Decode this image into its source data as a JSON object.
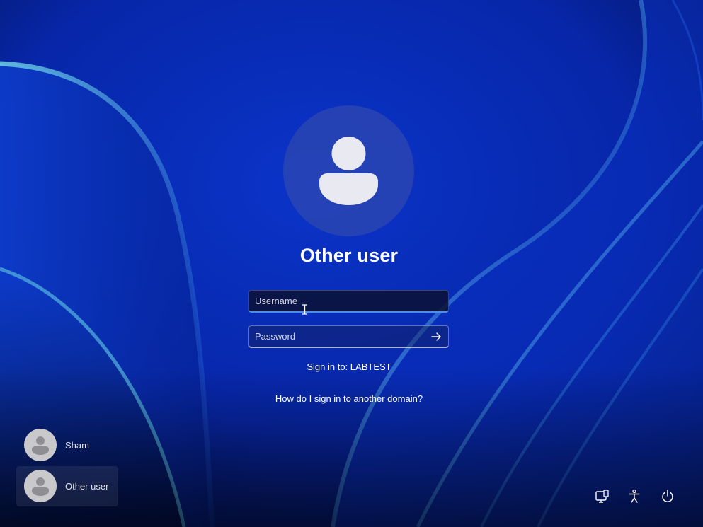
{
  "login": {
    "account_name": "Other user",
    "username_placeholder": "Username",
    "password_placeholder": "Password",
    "sign_in_to": "Sign in to: LABTEST",
    "domain_help_link": "How do I sign in to another domain?"
  },
  "user_switcher": {
    "users": [
      {
        "name": "Sham",
        "selected": false
      },
      {
        "name": "Other user",
        "selected": true
      }
    ]
  },
  "system_icons": [
    "network-icon",
    "accessibility-icon",
    "power-icon"
  ],
  "colors": {
    "background_dark": "#020c3a",
    "background_blue": "#0a2cc0",
    "focus_underline": "#4b8fe6",
    "text": "#ffffff"
  }
}
